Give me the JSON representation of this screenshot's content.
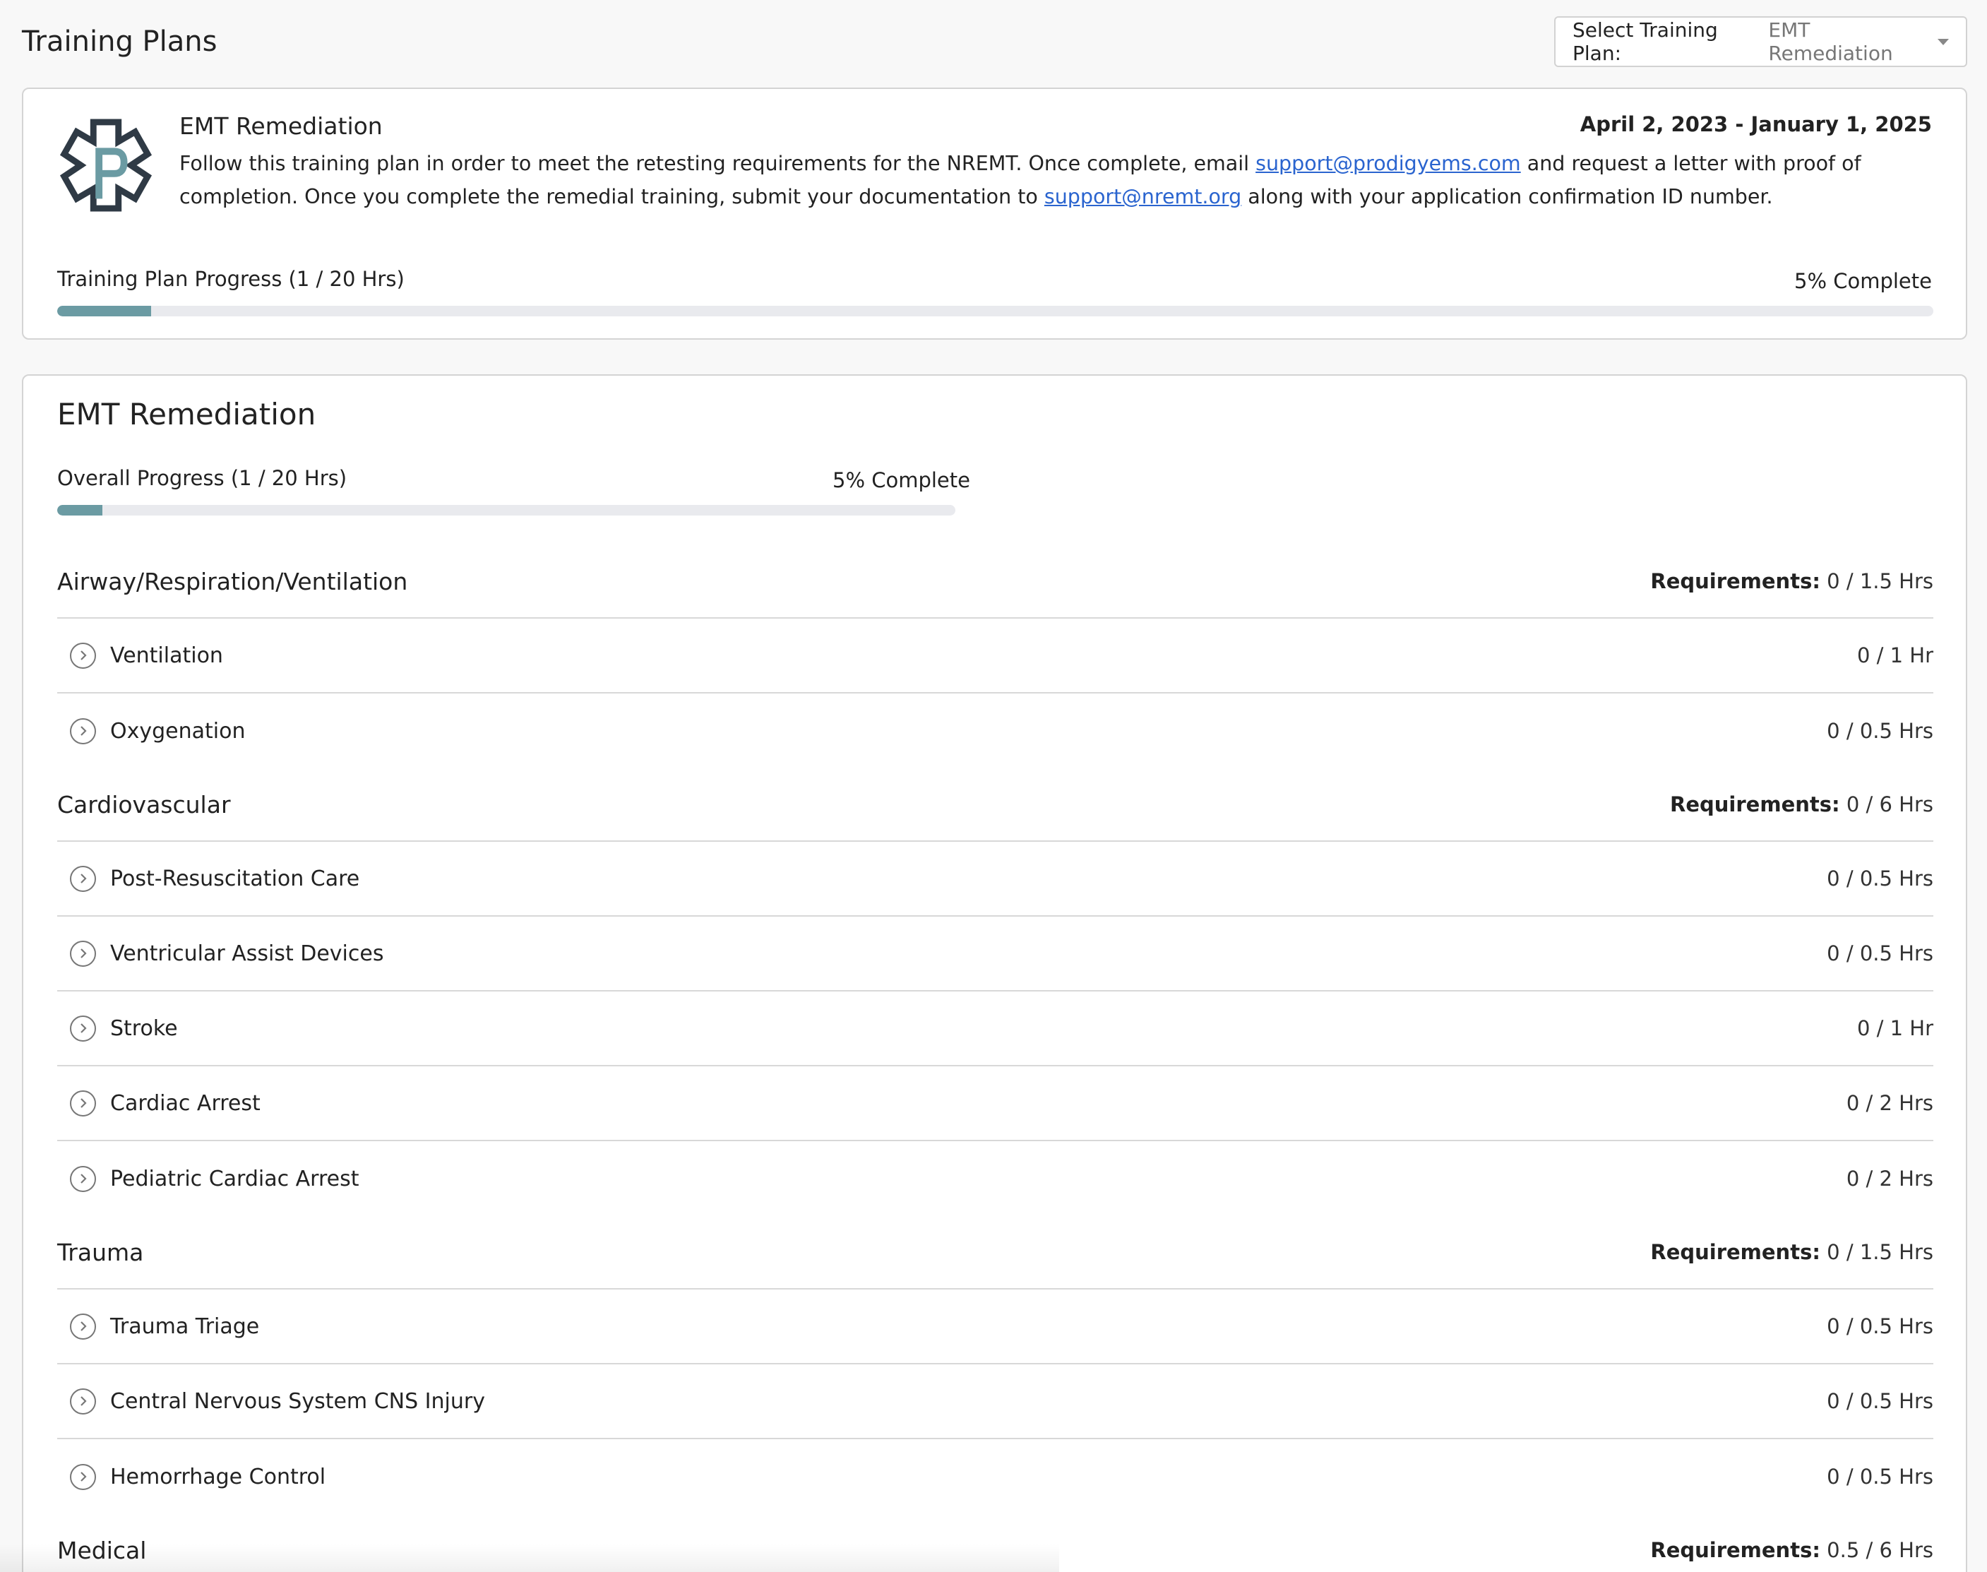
{
  "header": {
    "title": "Training Plans",
    "select_label": "Select Training Plan:",
    "select_value": "EMT Remediation"
  },
  "plan": {
    "name": "EMT Remediation",
    "dates": "April 2, 2023 - January 1, 2025",
    "desc_part1": "Follow this training plan in order to meet the retesting requirements for the NREMT. Once complete, email ",
    "email1": "support@prodigyems.com",
    "desc_part2": " and request a letter with proof of completion. Once you complete the remedial training, submit your documentation to ",
    "email2": "support@nremt.org",
    "desc_part3": " along with your application confirmation ID number.",
    "progress_label": "Training Plan Progress (1 / 20 Hrs)",
    "progress_pct_text": "5% Complete",
    "progress_fraction": 0.05
  },
  "main": {
    "title": "EMT Remediation",
    "progress_label": "Overall Progress (1 / 20 Hrs)",
    "progress_pct_text": "5% Complete",
    "progress_fraction": 0.05,
    "requirements_label": "Requirements:",
    "groups": [
      {
        "title": "Airway/Respiration/Ventilation",
        "requirement": "0 / 1.5 Hrs",
        "items": [
          {
            "name": "Ventilation",
            "hours": "0 / 1 Hr"
          },
          {
            "name": "Oxygenation",
            "hours": "0 / 0.5 Hrs"
          }
        ]
      },
      {
        "title": "Cardiovascular",
        "requirement": "0 / 6 Hrs",
        "items": [
          {
            "name": "Post-Resuscitation Care",
            "hours": "0 / 0.5 Hrs"
          },
          {
            "name": "Ventricular Assist Devices",
            "hours": "0 / 0.5 Hrs"
          },
          {
            "name": "Stroke",
            "hours": "0 / 1 Hr"
          },
          {
            "name": "Cardiac Arrest",
            "hours": "0 / 2 Hrs"
          },
          {
            "name": "Pediatric Cardiac Arrest",
            "hours": "0 / 2 Hrs"
          }
        ]
      },
      {
        "title": "Trauma",
        "requirement": "0 / 1.5 Hrs",
        "items": [
          {
            "name": "Trauma Triage",
            "hours": "0 / 0.5 Hrs"
          },
          {
            "name": "Central Nervous System CNS Injury",
            "hours": "0 / 0.5 Hrs"
          },
          {
            "name": "Hemorrhage Control",
            "hours": "0 / 0.5 Hrs"
          }
        ]
      },
      {
        "title": "Medical",
        "requirement": "0.5 / 6 Hrs",
        "items": []
      }
    ]
  },
  "colors": {
    "accent": "#6b9ba3",
    "link": "#2a64cf",
    "logo_dark": "#2f3a45"
  }
}
